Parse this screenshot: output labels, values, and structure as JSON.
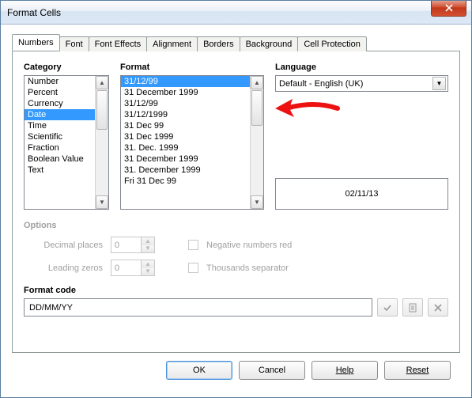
{
  "window": {
    "title": "Format Cells"
  },
  "tabs": [
    "Numbers",
    "Font",
    "Font Effects",
    "Alignment",
    "Borders",
    "Background",
    "Cell Protection"
  ],
  "headings": {
    "category": "Category",
    "format": "Format",
    "language": "Language"
  },
  "category": {
    "items": [
      "Number",
      "Percent",
      "Currency",
      "Date",
      "Time",
      "Scientific",
      "Fraction",
      "Boolean Value",
      "Text"
    ],
    "selectedIndex": 3
  },
  "format": {
    "items": [
      "31/12/99",
      "31 December 1999",
      "31/12/99",
      "31/12/1999",
      "31 Dec 99",
      "31 Dec 1999",
      "31. Dec. 1999",
      "31 December 1999",
      "31. December 1999",
      "Fri 31 Dec 99"
    ],
    "selectedIndex": 0
  },
  "language": {
    "selected": "Default - English (UK)"
  },
  "preview": {
    "value": "02/11/13"
  },
  "options": {
    "heading": "Options",
    "decimal_label": "Decimal places",
    "decimal_value": "0",
    "leading_label": "Leading zeros",
    "leading_value": "0",
    "neg_label": "Negative numbers red",
    "thou_label": "Thousands separator"
  },
  "format_code": {
    "heading": "Format code",
    "value": "DD/MM/YY"
  },
  "buttons": {
    "ok": "OK",
    "cancel": "Cancel",
    "help": "Help",
    "reset": "Reset"
  }
}
